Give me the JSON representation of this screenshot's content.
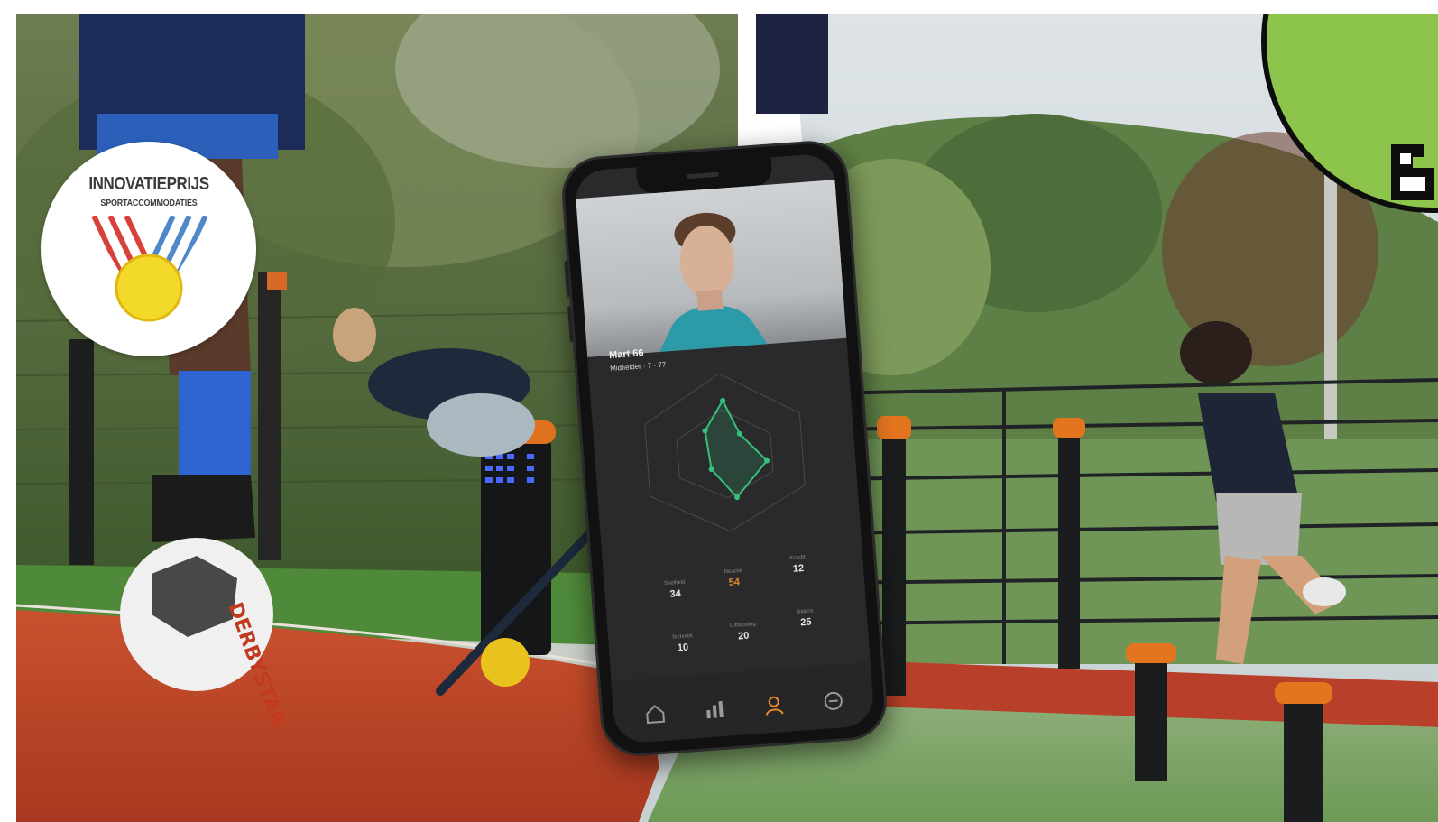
{
  "badge": {
    "title": "INNOVATIEPRIJS",
    "subtitle": "SPORTACCOMMODATIES"
  },
  "phone_app": {
    "player_name": "Mart 66",
    "player_meta": "Midfielder · 7 · 77",
    "stats": [
      {
        "label": "Snelheid",
        "value": "34",
        "accent": false
      },
      {
        "label": "Reactie",
        "value": "54",
        "accent": true
      },
      {
        "label": "Kracht",
        "value": "12",
        "accent": false
      },
      {
        "label": "Techniek",
        "value": "10",
        "accent": false
      },
      {
        "label": "Uithouding",
        "value": "20",
        "accent": false
      },
      {
        "label": "Balans",
        "value": "25",
        "accent": false
      }
    ],
    "tabs": [
      "home-icon",
      "stats-icon",
      "profile-icon",
      "settings-icon"
    ]
  },
  "ball_brand": "DERBYSTAR",
  "colors": {
    "logo_green": "#8dc44c",
    "track_red": "#b8402a",
    "turf_green": "#5f9a3a",
    "pole_orange": "#e4751f",
    "app_accent_green": "#36c07a"
  }
}
